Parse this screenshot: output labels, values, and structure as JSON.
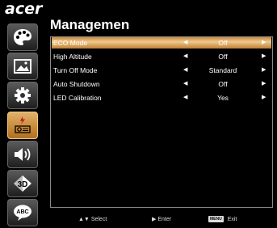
{
  "brand": "acer",
  "title": "Managemen",
  "sidebar": {
    "items": [
      {
        "icon": "palette-icon"
      },
      {
        "icon": "image-icon"
      },
      {
        "icon": "gear-icon"
      },
      {
        "icon": "projector-power-icon",
        "active": true
      },
      {
        "icon": "speaker-icon"
      },
      {
        "icon": "3d-icon",
        "text": "3D"
      },
      {
        "icon": "language-bubble-icon",
        "text": "ABC"
      }
    ]
  },
  "menu": {
    "items": [
      {
        "label": "ECO Mode",
        "value": "Off",
        "selected": true
      },
      {
        "label": "High Altitude",
        "value": "Off"
      },
      {
        "label": "Turn Off Mode",
        "value": "Standard"
      },
      {
        "label": "Auto Shutdown",
        "value": "Off"
      },
      {
        "label": "LED Calibration",
        "value": "Yes"
      }
    ],
    "left_arrow": "◀",
    "right_arrow": "▶"
  },
  "footer": {
    "select_icons": "▲▼",
    "select_label": "Select",
    "enter_icon": "▶",
    "enter_label": "Enter",
    "exit_key": "MENU",
    "exit_label": "Exit"
  }
}
